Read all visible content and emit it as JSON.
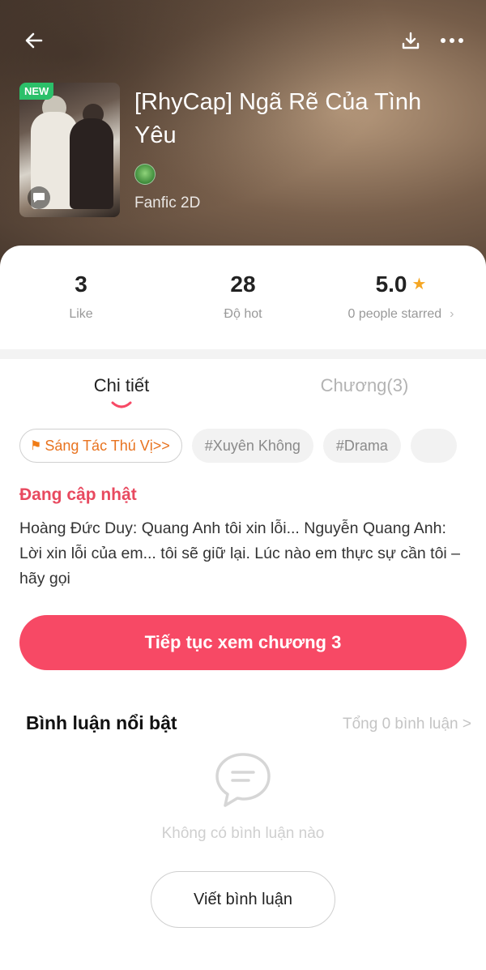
{
  "header": {
    "icons": {
      "back": "back-arrow-icon",
      "download": "download-icon",
      "more": "more-dots-icon"
    }
  },
  "book": {
    "badge": "NEW",
    "title": "[RhyCap] Ngã Rẽ Của Tình Yêu",
    "genre": "Fanfic 2D"
  },
  "stats": {
    "likes": {
      "value": "3",
      "label": "Like"
    },
    "hot": {
      "value": "28",
      "label": "Độ hot"
    },
    "rating": {
      "value": "5.0",
      "label": "0 people starred",
      "chevron": "›"
    }
  },
  "tabs": [
    {
      "label": "Chi tiết",
      "active": true
    },
    {
      "label": "Chương(3)",
      "active": false
    }
  ],
  "tags": [
    {
      "label": "Sáng Tác Thú Vị>>"
    },
    {
      "label": "#Xuyên Không"
    },
    {
      "label": "#Drama"
    }
  ],
  "status": "Đang cập nhật",
  "synopsis": "Hoàng Đức Duy: Quang Anh tôi xin lỗi... Nguyễn Quang Anh: Lời xin lỗi của em... tôi sẽ giữ lại. Lúc nào em thực sự cần tôi – hãy gọi",
  "continue_button": "Tiếp tục xem chương 3",
  "comments": {
    "title": "Bình luận nổi bật",
    "total": "Tổng 0 bình luận >",
    "empty": "Không có bình luận nào",
    "write_button": "Viết bình luận"
  },
  "colors": {
    "accent": "#f74965",
    "status_red": "#e8495f",
    "tag_orange": "#e8731f",
    "star": "#f5a623",
    "new_badge": "#2bc06a"
  }
}
